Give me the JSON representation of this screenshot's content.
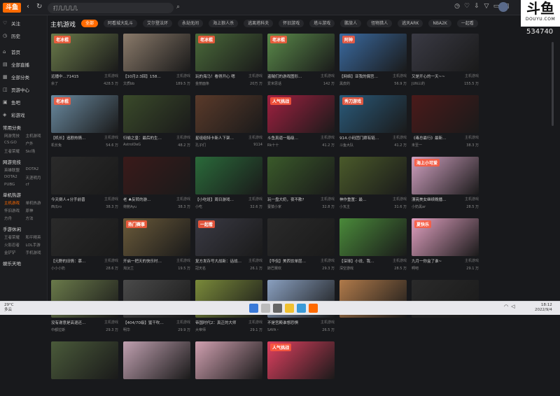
{
  "topbar": {
    "logo": "斗鱼",
    "search_text": "打几几几几",
    "icons": [
      "history-icon",
      "heart-icon",
      "download-icon",
      "shirt-icon",
      "message-icon",
      "box-icon"
    ]
  },
  "brand": {
    "big": "斗鱼",
    "small": "DOUYU.COM",
    "room_id": "534740"
  },
  "sidebar": {
    "top_items": [
      {
        "icon": "♡",
        "label": "关注"
      },
      {
        "icon": "◷",
        "label": "历史"
      },
      {
        "icon": "⌂",
        "label": "首页"
      },
      {
        "icon": "▤",
        "label": "全部直播"
      },
      {
        "icon": "▦",
        "label": "全部分类"
      },
      {
        "icon": "◫",
        "label": "页游中心"
      },
      {
        "icon": "▣",
        "label": "鱼吧"
      },
      {
        "icon": "◈",
        "label": "彩游戏"
      }
    ],
    "sections": [
      {
        "head": "常用分类",
        "items": [
          "网游竞技",
          "主机游戏",
          "CS:GO",
          "户外",
          "王者荣耀",
          "Ski场"
        ]
      },
      {
        "head": "网游竞技",
        "items": [
          "英雄联盟",
          "DOTA2",
          "DOTA2",
          "天涯明月",
          "PUBG",
          "cf"
        ]
      },
      {
        "head": "单机热游",
        "items": [
          "主机游戏",
          "单机热游",
          "怀旧游戏",
          "原神",
          "方舟",
          "方法"
        ]
      },
      {
        "head": "手游休闲",
        "items": [
          "王者荣耀",
          "和平精英",
          "火影忍者",
          "LOL手游",
          "金铲铲",
          "手机游戏"
        ]
      },
      {
        "head": "娱乐天地",
        "items": []
      }
    ]
  },
  "main": {
    "title": "主机游戏",
    "categories": [
      "全部",
      "阿看城大乱斗",
      "艾尔登法环",
      "永劫无间",
      "海上狼人杀",
      "逃离塔科夫",
      "怀旧游戏",
      "塔斗游戏",
      "鹏旅人",
      "怪物猎人",
      "逃天ARK",
      "NBA2K",
      "一起看"
    ],
    "cards": [
      {
        "title": "远播中…71415",
        "tag": "主机游戏",
        "user": "余了",
        "count": "428.5 万",
        "color": "#6a7a4a",
        "banner": "老冰棍"
      },
      {
        "title": "【10月2:3回】158…",
        "tag": "主机游戏",
        "user": "文质bb",
        "count": "189.5 万",
        "color": "#8a7a6a",
        "banner": ""
      },
      {
        "title": "玩的海马！看得开心 嗯",
        "tag": "主机游戏",
        "user": "金丽面条",
        "count": "20万 万",
        "color": "#4a6a3a",
        "banner": "老冰棍"
      },
      {
        "title": "盗贼们的游戏图形…",
        "tag": "主机游戏",
        "user": "爱米思话",
        "count": "142 万",
        "color": "#5a8a4a",
        "banner": "老冰棍"
      },
      {
        "title": "【网络】亚我的偶宫…",
        "tag": "主机游戏",
        "user": "黑皮的",
        "count": "56.9 万",
        "color": "#3a6aa0",
        "banner": "阿神"
      },
      {
        "title": "又是开心的一天~~",
        "tag": "主机游戏",
        "user": "JUN三的",
        "count": "155.5 万",
        "color": "#3a3a44",
        "banner": ""
      },
      {
        "title": "【机长】追剧热情…",
        "tag": "主机游戏",
        "user": "机长兔",
        "count": "54.6 万",
        "color": "#6a8aa0",
        "banner": "老冰棍"
      },
      {
        "title": "归偷之皇：最后的生…",
        "tag": "主机游戏",
        "user": "AstrolDeG",
        "count": "48.2 万",
        "color": "#3a4a2a",
        "banner": ""
      },
      {
        "title": "星组组特卡新人下架…",
        "tag": "主机游戏",
        "user": "孔子们",
        "count": "9114",
        "color": "#5a3a2a",
        "banner": ""
      },
      {
        "title": "斗鱼真逼一箱级…",
        "tag": "主机游戏",
        "user": "Rk十十",
        "count": "41.2 万",
        "color": "#a02040",
        "banner": "人气挑战"
      },
      {
        "title": "914.小码团门廊有链…",
        "tag": "主机游戏",
        "user": "斗鱼大队",
        "count": "41.2 万",
        "color": "#2a5a7a",
        "banner": "秀刀游戏"
      },
      {
        "title": "《毒总最行》最新…",
        "tag": "主机游戏",
        "user": "未至一",
        "count": "38.3 万",
        "color": "#4a1a1a",
        "banner": ""
      },
      {
        "title": "今天倒人+分手前晋",
        "tag": "主机游戏",
        "user": "西瓜ro",
        "count": "38.3 万",
        "color": "#2a2a2a",
        "banner": ""
      },
      {
        "title": "老 ♣反转的游…",
        "tag": "主机游戏",
        "user": "荷鲍Ayu",
        "count": "38.3 万",
        "color": "#3a1a1a",
        "banner": ""
      },
      {
        "title": "【小吃班】周日游戏…",
        "tag": "主机游戏",
        "user": "小吃",
        "count": "32.6 万",
        "color": "#2a6a3a",
        "banner": ""
      },
      {
        "title": "玩一盘大奶，夜不散?",
        "tag": "主机游戏",
        "user": "蚕猿小家",
        "count": "32.8 万",
        "color": "#3a5a2a",
        "banner": ""
      },
      {
        "title": "神作重置：最…",
        "tag": "主机游戏",
        "user": "小瓦主",
        "count": "31.6 万",
        "color": "#4a5a2a",
        "banner": ""
      },
      {
        "title": "漂亮美女继续晚播…",
        "tag": "主机游戏",
        "user": "小奶黑ar",
        "count": "28.5 万",
        "color": "#d0a0c0",
        "banner": "海上小可爱"
      },
      {
        "title": "【元野的旧情：慕…",
        "tag": "主机游戏",
        "user": "小小小奶",
        "count": "28.6 万",
        "color": "#2a2a2a",
        "banner": ""
      },
      {
        "title": "开启一把天的快乐时…",
        "tag": "主机游戏",
        "user": "淘汰兰",
        "count": "19.5 万",
        "color": "#6a5a3a",
        "banner": "热门赛事"
      },
      {
        "title": "复方发存号大战新：话战…",
        "tag": "主机游戏",
        "user": "冠天名",
        "count": "26.1 万",
        "color": "#3a3a44",
        "banner": "一起看"
      },
      {
        "title": "【华侃】美西饮单层…",
        "tag": "主机游戏",
        "user": "斯巴赛欢",
        "count": "29.3 万",
        "color": "#2a2a2a",
        "banner": ""
      },
      {
        "title": "【深球】小说、我…",
        "tag": "主机游戏",
        "user": "深空游戏",
        "count": "28.5 万",
        "color": "#4a8a3a",
        "banner": ""
      },
      {
        "title": "九月一你盒了谁~",
        "tag": "主机游戏",
        "user": "啊吧",
        "count": "29.1 万",
        "color": "#e0a0c0",
        "banner": "夏快乐"
      },
      {
        "title": "没有谢意是高退还…",
        "tag": "主机游戏",
        "user": "中都拉斯",
        "count": "29.3 万",
        "color": "#6a7a4a",
        "banner": ""
      },
      {
        "title": "【404/70级】猛干吹…",
        "tag": "主机游戏",
        "user": "明华",
        "count": "29.9 万",
        "color": "#4a4a4a",
        "banner": ""
      },
      {
        "title": "帝国时代2：真正的大师",
        "tag": "主机游戏",
        "user": "大帝师",
        "count": "29.1 万",
        "color": "#7a8a3a",
        "banner": ""
      },
      {
        "title": "不是宫殿谁想恐惧",
        "tag": "主机游戏",
        "user": "SAYA・",
        "count": "26.5 万",
        "color": "#8aa0c0",
        "banner": ""
      },
      {
        "title": "",
        "tag": "",
        "user": "",
        "count": "",
        "color": "#b07a4a",
        "banner": ""
      },
      {
        "title": "",
        "tag": "",
        "user": "",
        "count": "",
        "color": "#2a2a2a",
        "banner": ""
      },
      {
        "title": "",
        "tag": "",
        "user": "",
        "count": "",
        "color": "#4a5a3a",
        "banner": ""
      },
      {
        "title": "",
        "tag": "",
        "user": "",
        "count": "",
        "color": "#c0a0b0",
        "banner": ""
      },
      {
        "title": "",
        "tag": "",
        "user": "",
        "count": "",
        "color": "#d0a0b0",
        "banner": ""
      },
      {
        "title": "",
        "tag": "",
        "user": "",
        "count": "",
        "color": "#e04060",
        "banner": "人气挑战"
      }
    ]
  },
  "taskbar": {
    "weather": "29°C",
    "weather2": "多云",
    "time": "18:12",
    "date": "2022/9/4"
  }
}
